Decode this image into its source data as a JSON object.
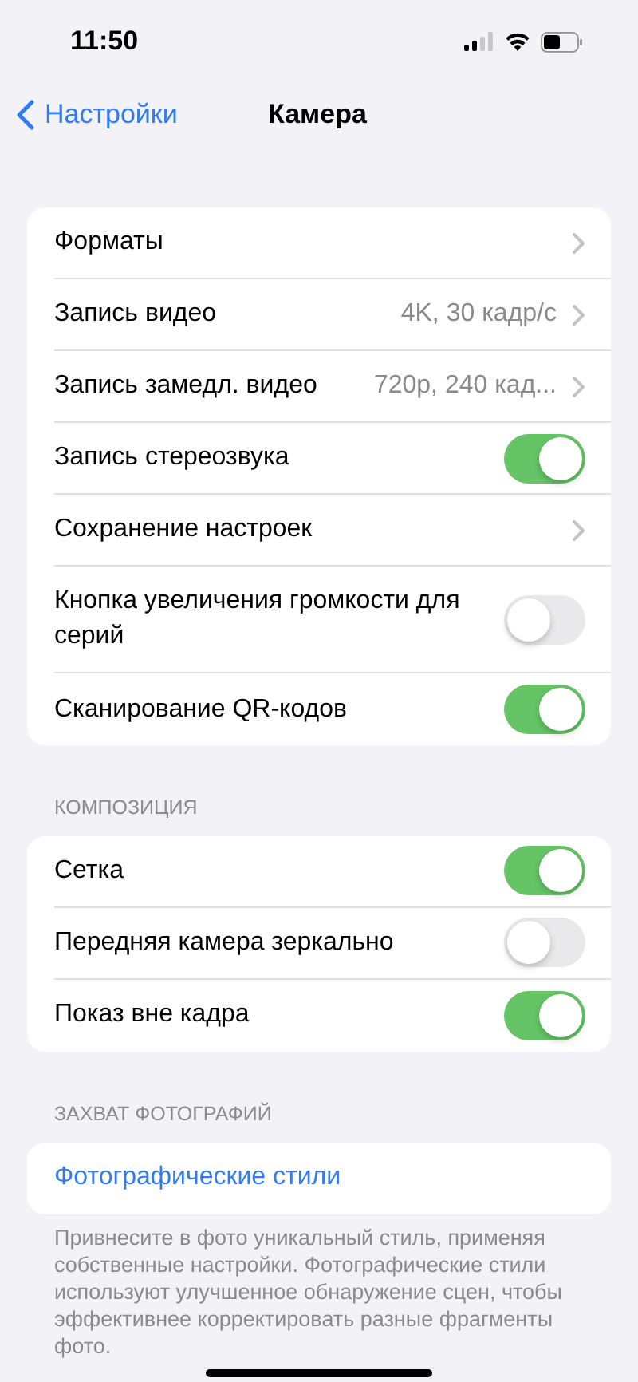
{
  "status_bar": {
    "time": "11:50"
  },
  "nav": {
    "back": "Настройки",
    "title": "Камера"
  },
  "sections": [
    {
      "rows": [
        {
          "kind": "link",
          "label": "Форматы"
        },
        {
          "kind": "link",
          "label": "Запись видео",
          "value": "4K, 30 кадр/с"
        },
        {
          "kind": "link",
          "label": "Запись замедл. видео",
          "value": "720p, 240 кад..."
        },
        {
          "kind": "toggle",
          "label": "Запись стереозвука",
          "on": true
        },
        {
          "kind": "link",
          "label": "Сохранение настроек"
        },
        {
          "kind": "toggle",
          "label": "Кнопка увеличения громкости для серий",
          "on": false
        },
        {
          "kind": "toggle",
          "label": "Сканирование QR-кодов",
          "on": true
        }
      ]
    },
    {
      "header": "КОМПОЗИЦИЯ",
      "rows": [
        {
          "kind": "toggle",
          "label": "Сетка",
          "on": true
        },
        {
          "kind": "toggle",
          "label": "Передняя камера зеркально",
          "on": false
        },
        {
          "kind": "toggle",
          "label": "Показ вне кадра",
          "on": true
        }
      ]
    },
    {
      "header": "ЗАХВАТ ФОТОГРАФИЙ",
      "rows": [
        {
          "kind": "action",
          "label": "Фотографические стили"
        }
      ],
      "footer": "Привнесите в фото уникальный стиль, применяя собственные настройки. Фотографические стили используют улучшенное обнаружение сцен, чтобы эффективнее корректировать разные фрагменты фото."
    }
  ]
}
